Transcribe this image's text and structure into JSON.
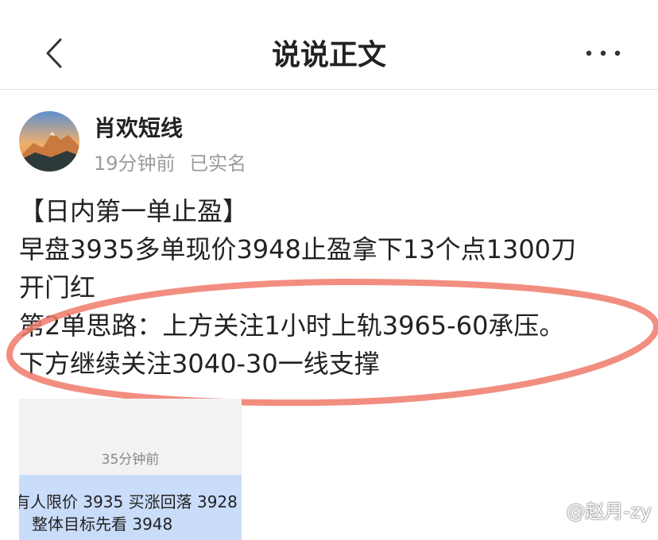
{
  "header": {
    "title": "说说正文",
    "back_icon": "chevron-left-icon",
    "more_icon": "more-dots-icon"
  },
  "post": {
    "author": "肖欢短线",
    "time": "19分钟前",
    "verified": "已实名",
    "lines": [
      "【日内第一单止盈】",
      "早盘3935多单现价3948止盈拿下13个点1300刀",
      "开门红",
      "第2单思路：上方关注1小时上轨3965-60承压。",
      "下方继续关注3040-30一线支撑"
    ],
    "highlight_color": "#f07a6a"
  },
  "thumbnail": {
    "time": "35分钟前",
    "line1": "有人限价 3935 买涨回落 3928",
    "line2": "整体目标先看 3948"
  },
  "watermark": "@赵月-zy"
}
